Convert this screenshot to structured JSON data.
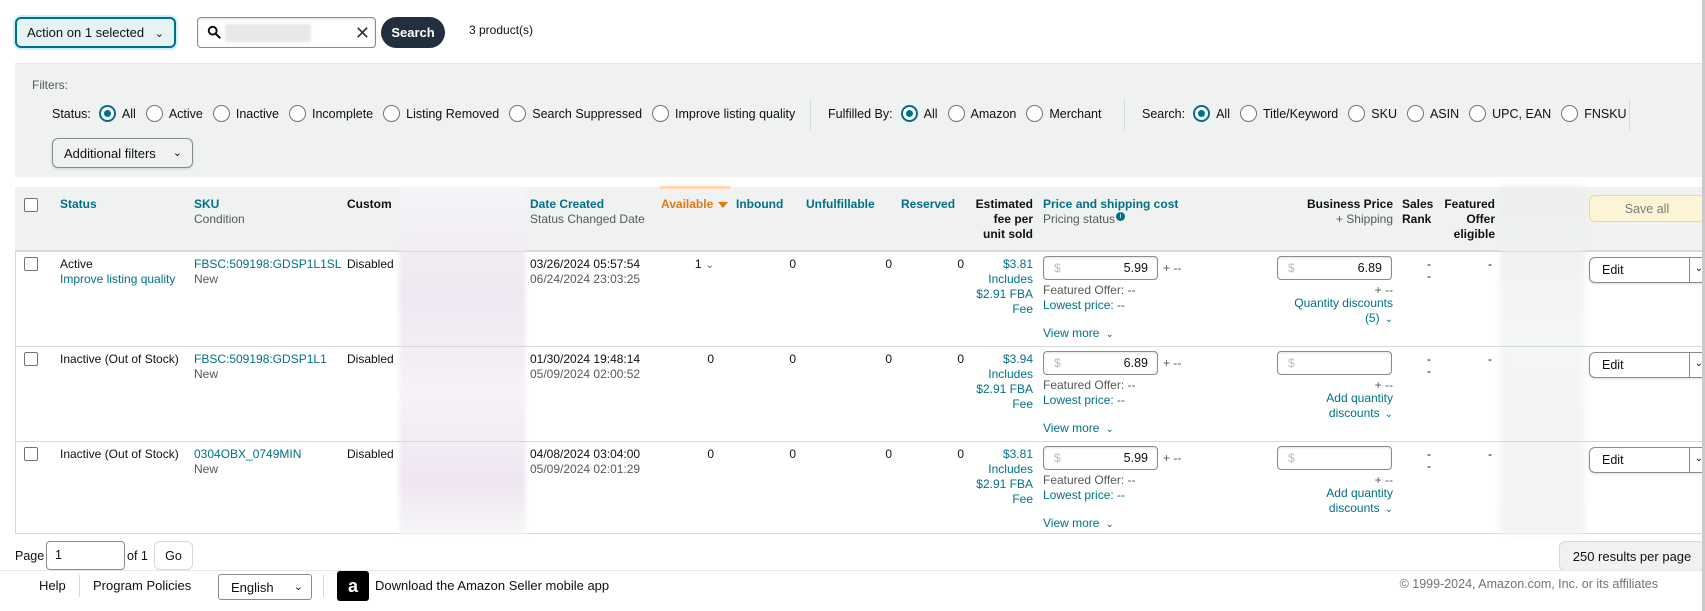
{
  "toolbar": {
    "action_label": "Action on 1 selected",
    "search_placeholder": "",
    "search_label": "Search",
    "product_count": "3 product(s)"
  },
  "filters": {
    "label": "Filters:",
    "status_label": "Status:",
    "status_options": [
      "All",
      "Active",
      "Inactive",
      "Incomplete",
      "Listing Removed",
      "Search Suppressed",
      "Improve listing quality"
    ],
    "fulfilled_label": "Fulfilled By:",
    "fulfilled_options": [
      "All",
      "Amazon",
      "Merchant"
    ],
    "search_label": "Search:",
    "search_options": [
      "All",
      "Title/Keyword",
      "SKU",
      "ASIN",
      "UPC, EAN",
      "FNSKU"
    ],
    "additional_label": "Additional filters"
  },
  "table": {
    "headers": {
      "status": "Status",
      "sku": "SKU",
      "condition": "Condition",
      "custom": "Custom",
      "date_created": "Date Created",
      "status_changed": "Status Changed Date",
      "available": "Available",
      "inbound": "Inbound",
      "unfulfillable": "Unfulfillable",
      "reserved": "Reserved",
      "est_fee_1": "Estimated",
      "est_fee_2": "fee per",
      "est_fee_3": "unit sold",
      "price": "Price and shipping cost",
      "pricing_status": "Pricing status",
      "business_price": "Business Price",
      "business_shipping": "+ Shipping",
      "sales_rank_1": "Sales",
      "sales_rank_2": "Rank",
      "featured_1": "Featured",
      "featured_2": "Offer",
      "featured_3": "eligible",
      "save_all": "Save all"
    },
    "rows": [
      {
        "status": "Active",
        "status_sub": "Improve listing quality",
        "sku": "FBSC:509198:GDSP1L1SL",
        "condition": "New",
        "custom": "Disabled",
        "date_created": "03/26/2024 05:57:54",
        "status_changed": "06/24/2024 23:03:25",
        "available": "1",
        "inbound": "0",
        "unfulfillable": "0",
        "reserved": "0",
        "fee": "$3.81",
        "fee_l2": "Includes",
        "fee_l3": "$2.91 FBA",
        "fee_l4": "Fee",
        "price": "5.99",
        "price_suffix": "+ --",
        "featured_offer": "Featured Offer: --",
        "lowest_price": "Lowest price: --",
        "view_more": "View more",
        "business_price": "6.89",
        "business_suffix": "+ --",
        "qd_l1": "Quantity discounts",
        "qd_l2": "(5)",
        "sales_rank": "-",
        "sales_rank_2": "-",
        "featured": "-",
        "edit": "Edit"
      },
      {
        "status": "Inactive (Out of Stock)",
        "status_sub": "",
        "sku": "FBSC:509198:GDSP1L1",
        "condition": "New",
        "custom": "Disabled",
        "date_created": "01/30/2024 19:48:14",
        "status_changed": "05/09/2024 02:00:52",
        "available": "0",
        "inbound": "0",
        "unfulfillable": "0",
        "reserved": "0",
        "fee": "$3.94",
        "fee_l2": "Includes",
        "fee_l3": "$2.91 FBA",
        "fee_l4": "Fee",
        "price": "6.89",
        "price_suffix": "+ --",
        "featured_offer": "Featured Offer: --",
        "lowest_price": "Lowest price: --",
        "view_more": "View more",
        "business_price": "",
        "business_suffix": "+ --",
        "qd_l1": "Add quantity",
        "qd_l2": "discounts",
        "sales_rank": "-",
        "sales_rank_2": "-",
        "featured": "-",
        "edit": "Edit"
      },
      {
        "status": "Inactive (Out of Stock)",
        "status_sub": "",
        "sku": "0304OBX_0749MIN",
        "condition": "New",
        "custom": "Disabled",
        "date_created": "04/08/2024 03:04:00",
        "status_changed": "05/09/2024 02:01:29",
        "available": "0",
        "inbound": "0",
        "unfulfillable": "0",
        "reserved": "0",
        "fee": "$3.81",
        "fee_l2": "Includes",
        "fee_l3": "$2.91 FBA",
        "fee_l4": "Fee",
        "price": "5.99",
        "price_suffix": "+ --",
        "featured_offer": "Featured Offer: --",
        "lowest_price": "Lowest price: --",
        "view_more": "View more",
        "business_price": "",
        "business_suffix": "+ --",
        "qd_l1": "Add quantity",
        "qd_l2": "discounts",
        "sales_rank": "-",
        "sales_rank_2": "-",
        "featured": "-",
        "edit": "Edit"
      }
    ]
  },
  "pager": {
    "page_label": "Page",
    "page_value": "1",
    "of_label": "of 1",
    "go_label": "Go",
    "per_page": "250 results per page"
  },
  "footer": {
    "help": "Help",
    "policies": "Program Policies",
    "language": "English",
    "app_label": "Download the Amazon Seller mobile app",
    "copyright": "© 1999-2024, Amazon.com, Inc. or its affiliates"
  },
  "icons": {
    "search": "search-icon",
    "clear": "close-icon",
    "chevron": "chevron-down-icon",
    "info": "info-icon",
    "app": "amazon-a-icon"
  },
  "colors": {
    "accent": "#007185",
    "sorted": "#e47911",
    "search_button": "#232f3e",
    "save_all_bg": "#fcf4d4"
  }
}
